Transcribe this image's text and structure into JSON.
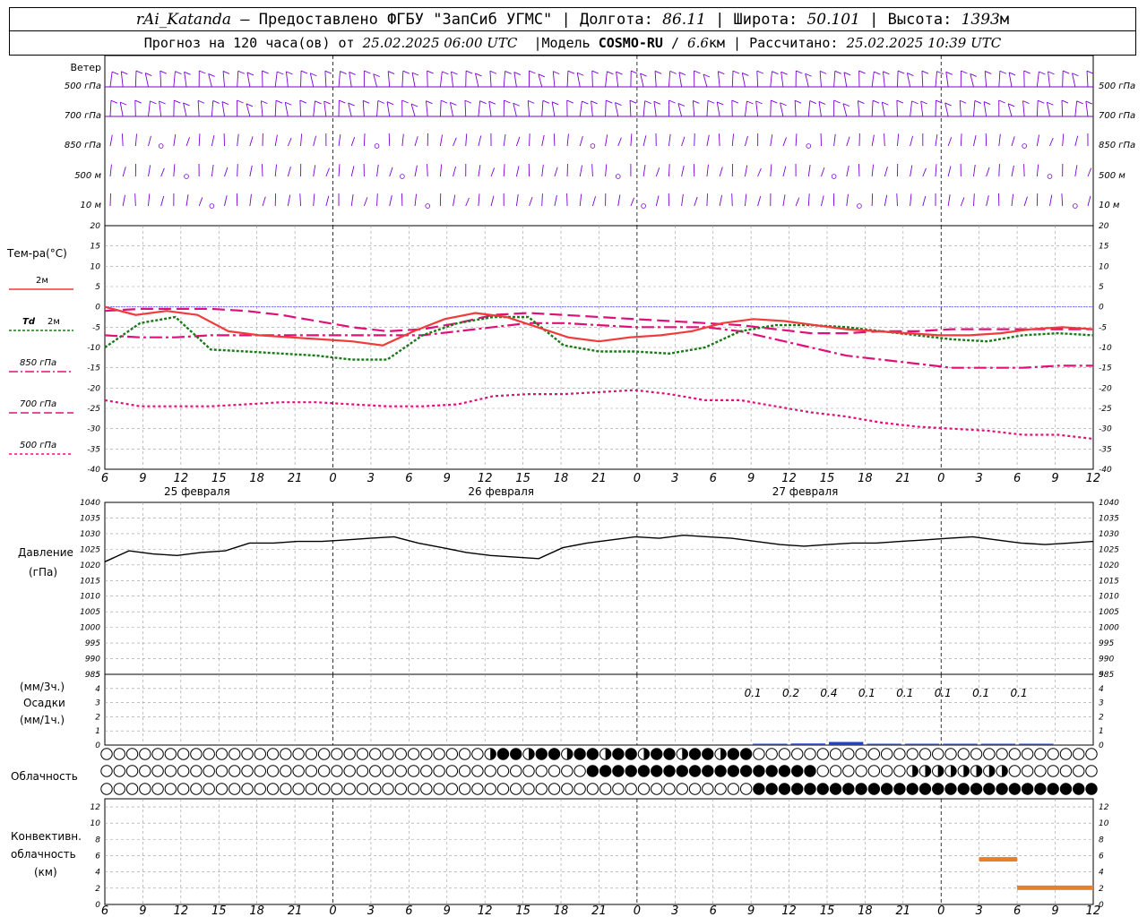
{
  "header": {
    "station": "rAi_Katanda",
    "dash": "—",
    "provided_by": "Предоставлено ФГБУ \"ЗапСиб УГМС\"",
    "lon_label": "Долгота:",
    "lon_value": "86.11",
    "lat_label": "Широта:",
    "lat_value": "50.101",
    "alt_label": "Высота:",
    "alt_value": "1393",
    "alt_unit": "м",
    "forecast_prefix": "Прогноз на 120 часа(ов) от",
    "forecast_time": "25.02.2025 06:00 UTC",
    "model_label": "Модель",
    "model_name": "COSMO-RU",
    "model_res": "6.6",
    "model_res_unit": "км",
    "calc_label": "Рассчитано:",
    "calc_time": "25.02.2025 10:39 UTC"
  },
  "colors": {
    "wind": "#7a00d4",
    "t2m": "#ef3b3b",
    "td2m": "#1a7a1a",
    "t850": "#e0107a",
    "t700": "#e0107a",
    "t500": "#e0107a",
    "pressure": "#000000",
    "precip": "#2040d0",
    "convective": "#e8802a",
    "grid": "#999999",
    "zero_line": "#6060ff"
  },
  "time_axis": {
    "tick_labels": [
      "6",
      "9",
      "12",
      "15",
      "18",
      "21",
      "0",
      "3",
      "6",
      "9",
      "12",
      "15",
      "18",
      "21",
      "0",
      "3",
      "6",
      "9",
      "12",
      "15",
      "18",
      "21",
      "0",
      "3",
      "6",
      "9",
      "12"
    ],
    "date_labels": [
      {
        "text": "25 февраля",
        "tick_index": 2
      },
      {
        "text": "26 февраля",
        "tick_index": 10
      },
      {
        "text": "27 февраля",
        "tick_index": 18
      }
    ]
  },
  "panels": {
    "wind": {
      "title": "Ветер",
      "levels": [
        "500 гПа",
        "700 гПа",
        "850 гПа",
        "500 м",
        "10 м"
      ]
    },
    "temperature": {
      "title": "Тем-ра(°C)",
      "y_ticks": [
        "20",
        "15",
        "10",
        "5",
        "0",
        "-5",
        "-10",
        "-15",
        "-20",
        "-25",
        "-30",
        "-35",
        "-40"
      ],
      "legend": [
        {
          "text": "2м"
        },
        {
          "text_a": "Td",
          "text_b": "2м"
        },
        {
          "text": "850 гПа"
        },
        {
          "text": "700 гПа"
        },
        {
          "text": "500 гПа"
        }
      ]
    },
    "pressure": {
      "title": "Давление",
      "unit": "(гПа)",
      "y_ticks": [
        "1040",
        "1035",
        "1030",
        "1025",
        "1020",
        "1015",
        "1010",
        "1005",
        "1000",
        "995",
        "990",
        "985"
      ]
    },
    "precip": {
      "unit_3h": "(мм/3ч.)",
      "title": "Осадки",
      "unit_1h": "(мм/1ч.)",
      "y_ticks": [
        "5",
        "4",
        "3",
        "2",
        "1",
        "0"
      ],
      "labels_3h": [
        "0.1",
        "0.2",
        "0.4",
        "0.1",
        "0.1",
        "0.1",
        "0.1",
        "0.1"
      ]
    },
    "clouds": {
      "title": "Облачность"
    },
    "convective": {
      "title_a": "Конвективн.",
      "title_b": "облачность",
      "unit": "(км)",
      "y_ticks": [
        "12",
        "10",
        "8",
        "6",
        "4",
        "2",
        "0"
      ]
    }
  },
  "chart_data": [
    {
      "type": "line",
      "title": "Тем-ра(°C)",
      "x_hours": [
        0,
        3,
        6,
        9,
        12,
        15,
        18,
        21,
        24,
        27,
        30,
        33,
        36,
        39,
        42,
        45,
        48,
        51,
        54,
        57,
        60,
        63,
        66,
        69,
        72,
        75,
        78
      ],
      "ylim": [
        -40,
        20
      ],
      "series": [
        {
          "name": "2м",
          "values": [
            0,
            -2,
            -1,
            -2,
            -6,
            -7,
            -7.5,
            -8,
            -8.5,
            -9.5,
            -6,
            -3,
            -1.5,
            -2.5,
            -5,
            -7.5,
            -8.5,
            -7.5,
            -7,
            -6,
            -4,
            -3,
            -3.5,
            -4.5,
            -5.5,
            -6,
            -6.5,
            -7,
            -7,
            -6.5,
            -5.5,
            -5,
            -5.5
          ]
        },
        {
          "name": "Td 2м",
          "values": [
            -10,
            -4,
            -2.5,
            -10.5,
            -11,
            -11.5,
            -12,
            -13,
            -13,
            -7,
            -4,
            -2.5,
            -2.5,
            -9.5,
            -11,
            -11,
            -11.5,
            -10,
            -6,
            -4.5,
            -4.5,
            -5,
            -6,
            -7,
            -8,
            -8.5,
            -7,
            -6.5,
            -7
          ]
        },
        {
          "name": "850 гПа",
          "values": [
            -7,
            -7.5,
            -7.5,
            -7,
            -7,
            -7,
            -7,
            -7,
            -7,
            -7,
            -6,
            -5,
            -4,
            -4,
            -4.5,
            -5,
            -5,
            -5,
            -6,
            -8,
            -10,
            -12,
            -13,
            -14,
            -15,
            -15,
            -15,
            -14.5,
            -14.5
          ]
        },
        {
          "name": "700 гПа",
          "values": [
            -1,
            -0.5,
            -0.5,
            -0.5,
            -1,
            -2,
            -3.5,
            -5,
            -6,
            -5.5,
            -4,
            -2,
            -1.5,
            -2,
            -2.5,
            -3,
            -3.5,
            -4,
            -4.5,
            -5.5,
            -6.5,
            -6.5,
            -6,
            -6,
            -5.5,
            -5.5,
            -5.5,
            -5.5,
            -5.5
          ]
        },
        {
          "name": "500 гПа",
          "values": [
            -23,
            -24.5,
            -24.5,
            -24.5,
            -24,
            -23.5,
            -23.5,
            -24,
            -24.5,
            -24.5,
            -24,
            -22,
            -21.5,
            -21.5,
            -21,
            -20.5,
            -21.5,
            -23,
            -23,
            -24.5,
            -26,
            -27,
            -28.5,
            -29.5,
            -30,
            -30.5,
            -31.5,
            -31.5,
            -32.5
          ]
        }
      ]
    },
    {
      "type": "line",
      "title": "Давление",
      "ylim": [
        985,
        1040
      ],
      "series": [
        {
          "name": "Давление",
          "values": [
            1021,
            1024.5,
            1023.5,
            1023,
            1024,
            1024.5,
            1027,
            1027,
            1027.5,
            1027.5,
            1028,
            1028.5,
            1029,
            1027,
            1025.5,
            1024,
            1023,
            1022.5,
            1022,
            1025.5,
            1027,
            1028,
            1029,
            1028.5,
            1029.5,
            1029,
            1028.5,
            1027.5,
            1026.5,
            1026,
            1026.5,
            1027,
            1027,
            1027.5,
            1028,
            1028.5,
            1029,
            1028,
            1027,
            1026.5,
            1027,
            1027.5
          ]
        }
      ]
    },
    {
      "type": "bar",
      "title": "Осадки",
      "ylim": [
        0,
        5
      ],
      "categories_3h": [
        "09",
        "12",
        "15",
        "18",
        "21",
        "00",
        "03",
        "06"
      ],
      "values_3h": [
        0.1,
        0.2,
        0.4,
        0.1,
        0.1,
        0.1,
        0.1,
        0.1
      ]
    },
    {
      "type": "bar",
      "title": "Конвективн. облачность",
      "ylim": [
        0,
        13
      ],
      "segments_km": [
        {
          "from_h": 69,
          "to_h": 72,
          "value": 5.5
        },
        {
          "from_h": 72,
          "to_h": 117,
          "value": 2
        }
      ]
    }
  ]
}
